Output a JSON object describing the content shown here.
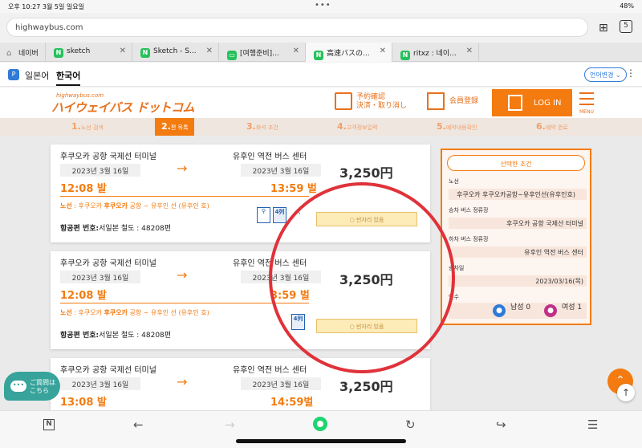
{
  "status": {
    "time": "오후 10:27  3월 5일 일요일",
    "dots": "•••",
    "battery": "48%"
  },
  "browser": {
    "url": "highwaybus.com",
    "tab_count": "5",
    "tabs": [
      {
        "label": "네이버",
        "icon": "home-icon"
      },
      {
        "label": "sketch",
        "icon": "N"
      },
      {
        "label": "Sketch - S...",
        "icon": "N"
      },
      {
        "label": "[여행준비]...",
        "icon": "N"
      },
      {
        "label": "高速バスの...",
        "icon": "N"
      },
      {
        "label": "ritxz : 네이...",
        "icon": "N"
      }
    ]
  },
  "translate": {
    "lang_ja": "일본어",
    "lang_ko": "한국어",
    "settings": "언어변경 ⌄",
    "more": "⋮",
    "papago_icon": "P"
  },
  "site": {
    "logo_small": "highwaybus.com",
    "logo": "ハイウェイバス ドットコム",
    "reserve_check_1": "予約確認",
    "reserve_check_2": "決済・取り消し",
    "member_register": "会員登録",
    "login": "LOG IN",
    "menu": "MENU"
  },
  "steps": [
    {
      "num": "1.",
      "label": "노선 검색"
    },
    {
      "num": "2.",
      "label": "편 목록"
    },
    {
      "num": "3.",
      "label": "좌석 조건"
    },
    {
      "num": "4.",
      "label": "고객정보입력"
    },
    {
      "num": "5.",
      "label": "예약내용확인"
    },
    {
      "num": "6.",
      "label": "예약 완료"
    }
  ],
  "results": [
    {
      "dep_stop": "후쿠오카 공항 국제선 터미널",
      "arr_stop": "유후인 역전 버스 센터",
      "dep_date": "2023년 3월 16일",
      "arr_date": "2023년 3월 16일",
      "dep_time": "12:08 발",
      "arr_time": "13:59 벌",
      "price": "3,250円",
      "route_label": "노선",
      "route_text": " : 후쿠오카 ",
      "route_bold": "후쿠오카",
      "route_rest": " 공항 ~ 유후인 선 (유후인 호)",
      "flight_label": "항공편 번호:",
      "flight_value": "서일본 철도 : 48208편",
      "vacancy": "○ 빈자리 있음",
      "seat_label": "4列"
    },
    {
      "dep_stop": "후쿠오카 공항 국제선 터미널",
      "arr_stop": "유후인 역전 버스 센터",
      "dep_date": "2023년 3월 16일",
      "arr_date": "2023년 3월 16일",
      "dep_time": "12:08 발",
      "arr_time": "3:59 벌",
      "price": "3,250円",
      "route_label": "노선",
      "route_text": " : 후쿠오카 ",
      "route_bold": "후쿠오카",
      "route_rest": " 공항 ~ 유후인 선 (유후인 호)",
      "flight_label": "항공편 번호:",
      "flight_value": "서일본 철도 : 48208편",
      "vacancy": "○ 빈자리 있음",
      "seat_label": "4列"
    },
    {
      "dep_stop": "후쿠오카 공항 국제선 터미널",
      "arr_stop": "유후인 역전 버스 센터",
      "dep_date": "2023년 3월 16일",
      "arr_date": "2023년 3월 16일",
      "dep_time": "13:08 발",
      "arr_time": "14:59벌",
      "price": "3,250円"
    }
  ],
  "sidebar": {
    "title": "선택한 조건",
    "route_label": "노선",
    "route_value": "후쿠오카 후쿠오카공항~유후인선(유후인호)",
    "board_label": "승차 버스 정류장",
    "board_value": "후쿠오카 공항 국제선 터미널",
    "alight_label": "하차 버스 정류장",
    "alight_value": "유후인 역전 버스 센터",
    "date_label": "승차일",
    "date_value": "2023/03/16(목)",
    "pax_label": "인수",
    "male": "남성 0",
    "female": "여성 1"
  },
  "chat": {
    "text1": "ご質問は",
    "text2": "こちら",
    "bubble": "•••"
  },
  "colors": {
    "accent": "#f37b10",
    "annotation_circle": "#e0323a"
  }
}
